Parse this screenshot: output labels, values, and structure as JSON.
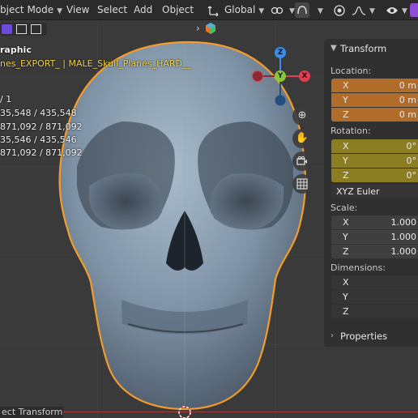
{
  "menubar": {
    "mode": "bject Mode",
    "view": "View",
    "select": "Select",
    "add": "Add",
    "object": "Object",
    "orientation": "Global"
  },
  "overlay": {
    "view_name": "raphic",
    "collection": "nes_EXPORT_ | MALE_Skull_Planes_HARD__",
    "objects": "/ 1",
    "vertices": "35,548 / 435,548",
    "edges": "871,092 / 871,092",
    "faces": "35,546 / 435,546",
    "triangles": "871,092 / 871,092"
  },
  "gizmo": {
    "z": "Z",
    "y": "Y",
    "x": "X"
  },
  "npanel": {
    "transform_header": "Transform",
    "location_label": "Location:",
    "location": [
      {
        "axis": "X",
        "value": "0 m"
      },
      {
        "axis": "Y",
        "value": "0 m"
      },
      {
        "axis": "Z",
        "value": "0 m"
      }
    ],
    "rotation_label": "Rotation:",
    "rotation": [
      {
        "axis": "X",
        "value": "0°"
      },
      {
        "axis": "Y",
        "value": "0°"
      },
      {
        "axis": "Z",
        "value": "0°"
      }
    ],
    "rotation_mode": "XYZ Euler",
    "scale_label": "Scale:",
    "scale": [
      {
        "axis": "X",
        "value": "1.000"
      },
      {
        "axis": "Y",
        "value": "1.000"
      },
      {
        "axis": "Z",
        "value": "1.000"
      }
    ],
    "dimensions_label": "Dimensions:",
    "dimensions": [
      {
        "axis": "X",
        "value": ""
      },
      {
        "axis": "Y",
        "value": ""
      },
      {
        "axis": "Z",
        "value": ""
      }
    ],
    "properties_header": "Properties"
  },
  "status": {
    "last_operator": "ect Transform"
  },
  "colors": {
    "selection_outline": "#f39c2c",
    "location_field": "#b26c2a",
    "rotation_field": "#8a7d22",
    "axis_x": "#e0404f",
    "axis_y": "#8cc63f",
    "axis_z": "#3a8ee6"
  }
}
